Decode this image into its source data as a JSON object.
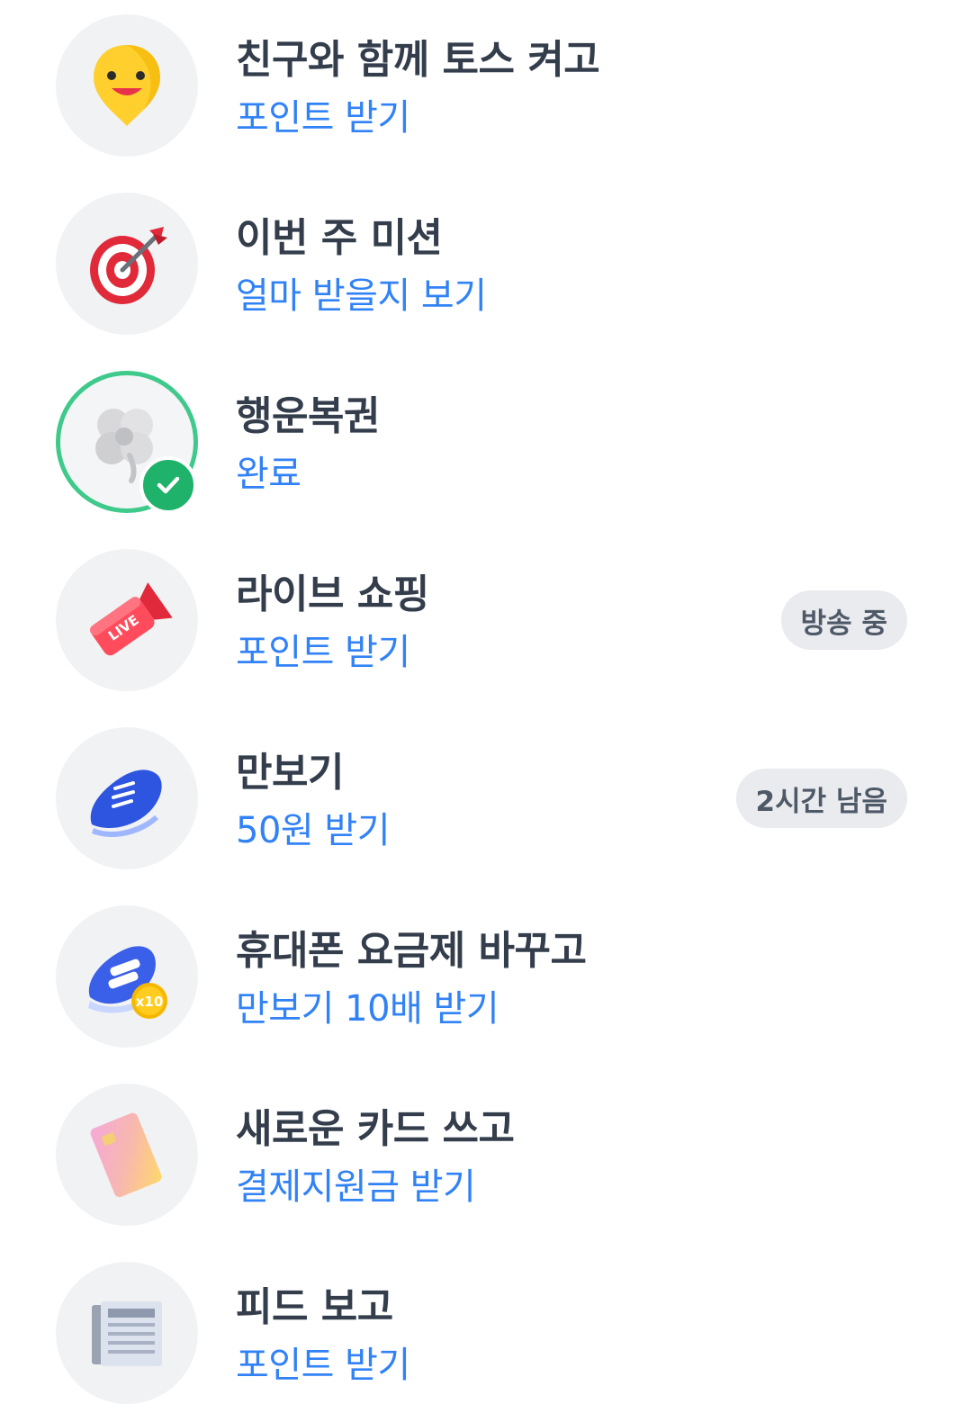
{
  "missions": [
    {
      "title": "친구와 함께 토스 켜고",
      "subtitle": "포인트 받기",
      "icon": "smiley-pin-icon",
      "badge": ""
    },
    {
      "title": "이번 주 미션",
      "subtitle": "얼마 받을지 보기",
      "icon": "target-dart-icon",
      "badge": ""
    },
    {
      "title": "행운복권",
      "subtitle": "완료",
      "icon": "clover-icon",
      "badge": "",
      "completed": true
    },
    {
      "title": "라이브 쇼핑",
      "subtitle": "포인트 받기",
      "icon": "live-megaphone-icon",
      "badge": "방송 중"
    },
    {
      "title": "만보기",
      "subtitle": "50원 받기",
      "icon": "sneaker-icon",
      "badge": "2시간 남음"
    },
    {
      "title": "휴대폰 요금제 바꾸고",
      "subtitle": "만보기 10배 받기",
      "icon": "sneaker-x10-icon",
      "badge": "",
      "icon_badge": "x10"
    },
    {
      "title": "새로운 카드 쓰고",
      "subtitle": "결제지원금 받기",
      "icon": "credit-card-icon",
      "badge": ""
    },
    {
      "title": "피드 보고",
      "subtitle": "포인트 받기",
      "icon": "newspaper-icon",
      "badge": ""
    }
  ],
  "colors": {
    "title": "#333d4b",
    "subtitle": "#3182f6",
    "badge_bg": "#eaebee",
    "icon_bg": "#f1f2f4",
    "complete": "#1fb26b"
  }
}
